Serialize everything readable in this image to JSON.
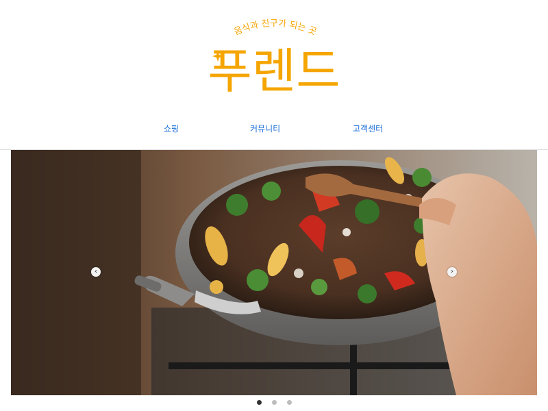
{
  "brand": {
    "tagline": "음식과 친구가 되는 곳",
    "logo_text": "푸렌드",
    "color": "#f5a500"
  },
  "nav": {
    "items": [
      {
        "label": "쇼핑"
      },
      {
        "label": "커뮤니티"
      },
      {
        "label": "고객센터"
      }
    ],
    "link_color": "#1a6fd8"
  },
  "hero": {
    "image_description_icon": "wok-stir-fry-photo",
    "prev_icon": "chevron-left-icon",
    "next_icon": "chevron-right-icon",
    "prev_glyph": "‹",
    "next_glyph": "›",
    "slides_total": 3,
    "active_slide": 1
  }
}
